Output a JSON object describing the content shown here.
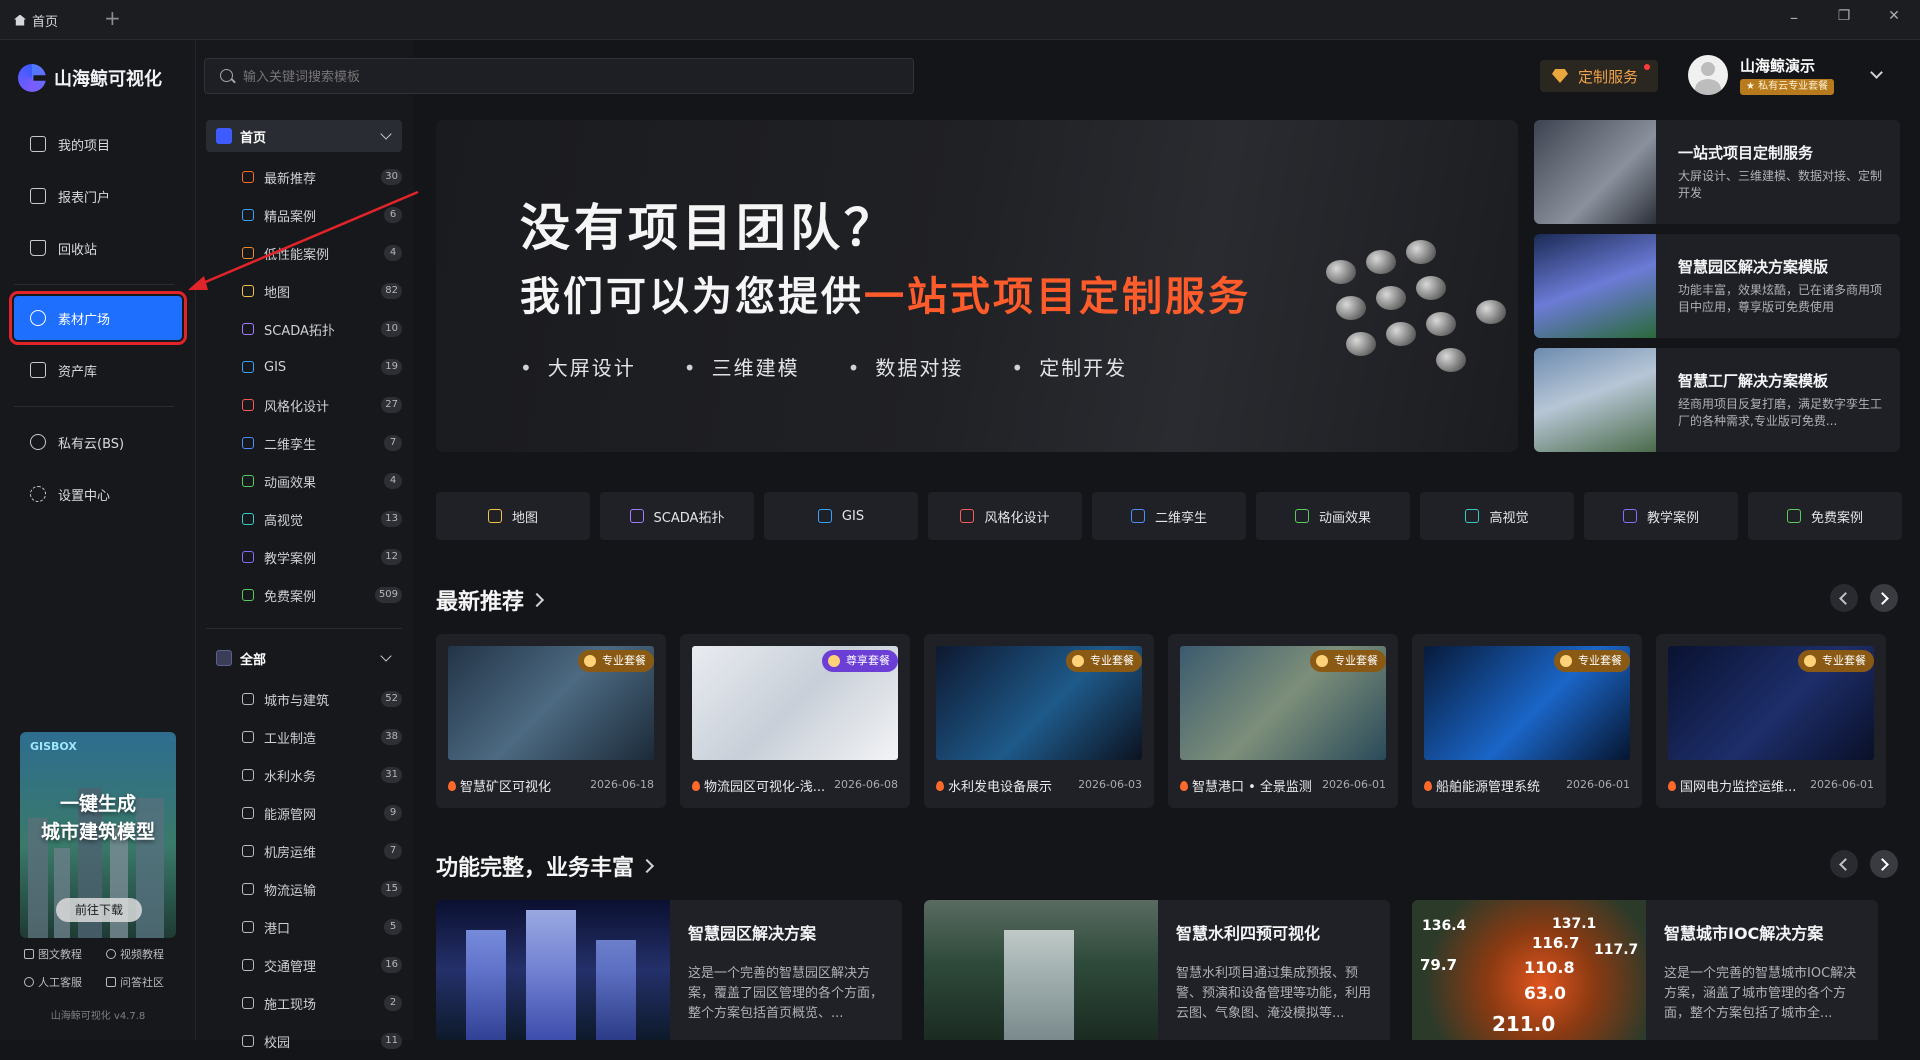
{
  "titlebar": {
    "tab_label": "首页",
    "add_tab": "+",
    "min": "–",
    "restore": "❐",
    "close": "✕"
  },
  "brand": {
    "name": "山海鲸可视化"
  },
  "nav": {
    "items": [
      {
        "label": "我的项目"
      },
      {
        "label": "报表门户"
      },
      {
        "label": "回收站"
      },
      {
        "label": "素材广场"
      },
      {
        "label": "资产库"
      },
      {
        "label": "私有云(BS)"
      },
      {
        "label": "设置中心"
      }
    ]
  },
  "promo": {
    "brand": "GISBOX",
    "line1": "一键生成",
    "line2": "城市建筑模型",
    "button": "前往下载"
  },
  "help": {
    "doc": "图文教程",
    "video": "视频教程",
    "service": "人工客服",
    "community": "问答社区"
  },
  "version": "山海鲸可视化 v4.7.8",
  "home_group": {
    "title": "首页",
    "items": [
      {
        "label": "最新推荐",
        "count": "30",
        "color": "#ff6a2b"
      },
      {
        "label": "精品案例",
        "count": "6",
        "color": "#3aa0ff"
      },
      {
        "label": "低性能案例",
        "count": "4",
        "color": "#f08a2b"
      },
      {
        "label": "地图",
        "count": "82",
        "color": "#f2c14a"
      },
      {
        "label": "SCADA拓扑",
        "count": "10",
        "color": "#a27bff"
      },
      {
        "label": "GIS",
        "count": "19",
        "color": "#3aa0ff"
      },
      {
        "label": "风格化设计",
        "count": "27",
        "color": "#ff5a5a"
      },
      {
        "label": "二维孪生",
        "count": "7",
        "color": "#4c8dff"
      },
      {
        "label": "动画效果",
        "count": "4",
        "color": "#5ac85a"
      },
      {
        "label": "高视觉",
        "count": "13",
        "color": "#3ac9c9"
      },
      {
        "label": "教学案例",
        "count": "12",
        "color": "#8a6bff"
      },
      {
        "label": "免费案例",
        "count": "509",
        "color": "#5ac85a"
      }
    ]
  },
  "all_group": {
    "title": "全部",
    "items": [
      {
        "label": "城市与建筑",
        "count": "52"
      },
      {
        "label": "工业制造",
        "count": "38"
      },
      {
        "label": "水利水务",
        "count": "31"
      },
      {
        "label": "能源管网",
        "count": "9"
      },
      {
        "label": "机房运维",
        "count": "7"
      },
      {
        "label": "物流运输",
        "count": "15"
      },
      {
        "label": "港口",
        "count": "5"
      },
      {
        "label": "交通管理",
        "count": "16"
      },
      {
        "label": "施工现场",
        "count": "2"
      },
      {
        "label": "校园",
        "count": "11"
      }
    ]
  },
  "search": {
    "placeholder": "输入关键词搜索模板"
  },
  "custom_service": "定制服务",
  "user": {
    "name": "山海鲸演示",
    "badge": "★ 私有云专业套餐"
  },
  "hero": {
    "line1": "没有项目团队？",
    "line2_prefix": "我们可以为您提供",
    "line2_highlight": "一站式项目定制服务",
    "bullets": [
      "大屏设计",
      "三维建模",
      "数据对接",
      "定制开发"
    ]
  },
  "side_cards": [
    {
      "title": "一站式项目定制服务",
      "desc": "大屏设计、三维建模、数据对接、定制开发"
    },
    {
      "title": "智慧园区解决方案模版",
      "desc": "功能丰富，效果炫酷，已在诸多商用项目中应用，尊享版可免费使用"
    },
    {
      "title": "智慧工厂解决方案模板",
      "desc": "经商用项目反复打磨，满足数字孪生工厂的各种需求,专业版可免费..."
    }
  ],
  "quick_tags": [
    {
      "label": "地图",
      "color": "#f2c14a"
    },
    {
      "label": "SCADA拓扑",
      "color": "#a27bff"
    },
    {
      "label": "GIS",
      "color": "#3aa0ff"
    },
    {
      "label": "风格化设计",
      "color": "#ff5a5a"
    },
    {
      "label": "二维孪生",
      "color": "#4c8dff"
    },
    {
      "label": "动画效果",
      "color": "#5ac85a"
    },
    {
      "label": "高视觉",
      "color": "#3ac9c9"
    },
    {
      "label": "教学案例",
      "color": "#8a6bff"
    },
    {
      "label": "免费案例",
      "color": "#5ac85a"
    }
  ],
  "section_latest": {
    "title": "最新推荐"
  },
  "recommendations": [
    {
      "name": "智慧矿区可视化",
      "date": "2026-06-18",
      "tier": "专业套餐"
    },
    {
      "name": "物流园区可视化-浅...",
      "date": "2026-06-08",
      "tier": "尊享套餐"
    },
    {
      "name": "水利发电设备展示",
      "date": "2026-06-03",
      "tier": "专业套餐"
    },
    {
      "name": "智慧港口 • 全景监测",
      "date": "2026-06-01",
      "tier": "专业套餐"
    },
    {
      "name": "船舶能源管理系统",
      "date": "2026-06-01",
      "tier": "专业套餐"
    },
    {
      "name": "国网电力监控运维...",
      "date": "2026-06-01",
      "tier": "专业套餐"
    }
  ],
  "section_solutions": {
    "title": "功能完整，业务丰富"
  },
  "solutions": [
    {
      "name": "智慧园区解决方案",
      "desc": "这是一个完善的智慧园区解决方案，覆盖了园区管理的各个方面，整个方案包括首页概览、..."
    },
    {
      "name": "智慧水利四预可视化",
      "desc": "智慧水利项目通过集成预报、预警、预演和设备管理等功能，利用云图、气象图、淹没模拟等..."
    },
    {
      "name": "智慧城市IOC解决方案",
      "desc": "这是一个完善的智慧城市IOC解决方案，涵盖了城市管理的各个方面，整个方案包括了城市全..."
    }
  ],
  "solution_thumb_numbers": [
    "136.4",
    "137.1",
    "116.7",
    "117.7",
    "79.7",
    "110.8",
    "63.0",
    "211.0"
  ],
  "colors": {
    "accent": "#1f6fff",
    "annotation": "#e0242a",
    "hero_highlight": "#ff5b2b",
    "custom": "#f0a34b"
  }
}
